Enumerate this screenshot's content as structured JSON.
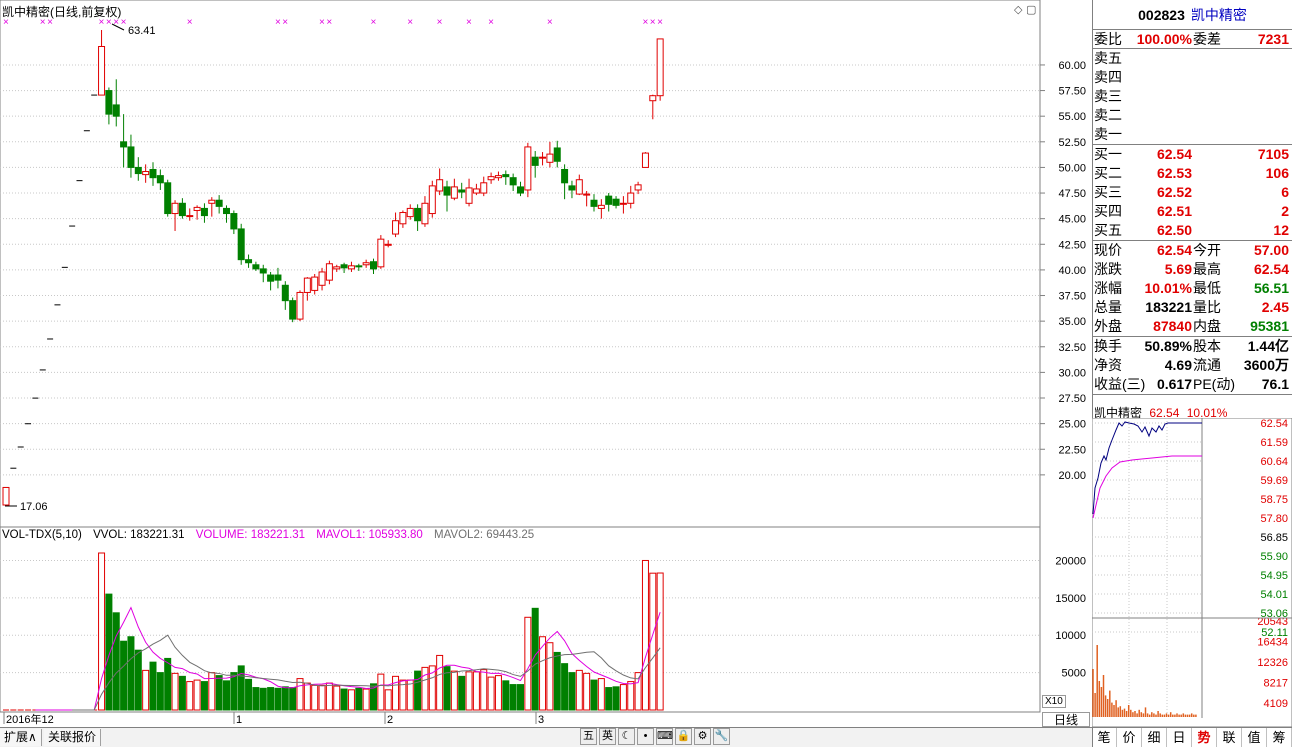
{
  "chart_title": "凯中精密(日线,前复权)",
  "vol_legend": {
    "label": "VOL-TDX(5,10)",
    "vvol": "VVOL: 183221.31",
    "volume": "VOLUME: 183221.31",
    "mavol1": "MAVOL1: 105933.80",
    "mavol2": "MAVOL2: 69443.25"
  },
  "colors": {
    "up": "#e00000",
    "down": "#008000",
    "ma1": "#e000e0",
    "ma2": "#707070",
    "grid": "#c8c8c8"
  },
  "price_axis_labels": [
    "60.00",
    "57.50",
    "55.00",
    "52.50",
    "50.00",
    "47.50",
    "45.00",
    "42.50",
    "40.00",
    "37.50",
    "35.00",
    "32.50",
    "30.00",
    "27.50",
    "25.00",
    "22.50",
    "20.00"
  ],
  "vol_axis_labels": [
    "20000",
    "15000",
    "10000",
    "5000"
  ],
  "annotations": {
    "high": "63.41",
    "low": "17.06"
  },
  "x_labels": {
    "year": "2016年12",
    "m1": "1",
    "m2": "2",
    "m3": "3"
  },
  "chart_data": {
    "type": "candlestick",
    "ylim": [
      17,
      63.5
    ],
    "vol_ylim": [
      0,
      21000
    ],
    "candles": [
      [
        17.06,
        18.77,
        17.06,
        18.77,
        0
      ],
      [
        18.77,
        20.65,
        18.77,
        20.65,
        0
      ],
      [
        20.65,
        22.72,
        20.65,
        22.72,
        0
      ],
      [
        22.72,
        24.99,
        22.72,
        24.99,
        0
      ],
      [
        24.99,
        27.49,
        24.99,
        27.49,
        0
      ],
      [
        27.49,
        30.24,
        27.49,
        30.24,
        0
      ],
      [
        30.24,
        33.26,
        30.24,
        33.26,
        0
      ],
      [
        33.26,
        36.59,
        33.26,
        36.59,
        0
      ],
      [
        36.59,
        40.25,
        36.59,
        40.25,
        0
      ],
      [
        40.25,
        44.28,
        40.25,
        44.28,
        0
      ],
      [
        44.28,
        48.71,
        44.28,
        48.71,
        0
      ],
      [
        48.71,
        53.58,
        48.71,
        53.58,
        0
      ],
      [
        53.58,
        57.06,
        53.58,
        57.06,
        0
      ],
      [
        57.06,
        61.8,
        57.06,
        63.41,
        21000
      ],
      [
        57.5,
        55.2,
        54.2,
        57.8,
        15500
      ],
      [
        56.1,
        55.0,
        54.0,
        58.6,
        13000
      ],
      [
        52.5,
        52.0,
        50.0,
        55.2,
        9200
      ],
      [
        52.0,
        50.0,
        49.0,
        53.2,
        9800
      ],
      [
        50.0,
        49.4,
        48.7,
        51.0,
        8000
      ],
      [
        49.3,
        49.6,
        48.5,
        50.3,
        5300
      ],
      [
        49.8,
        49.0,
        48.2,
        50.5,
        6400
      ],
      [
        49.2,
        48.5,
        47.8,
        49.8,
        5000
      ],
      [
        48.5,
        45.5,
        45.2,
        48.8,
        6900
      ],
      [
        45.5,
        46.5,
        43.8,
        46.8,
        4900
      ],
      [
        46.5,
        45.3,
        45.0,
        47.0,
        4500
      ],
      [
        45.3,
        45.3,
        44.8,
        46.0,
        3800
      ],
      [
        45.8,
        46.1,
        44.9,
        46.3,
        4000
      ],
      [
        46.0,
        45.3,
        44.6,
        46.5,
        3800
      ],
      [
        46.5,
        46.8,
        45.2,
        47.1,
        5000
      ],
      [
        46.8,
        46.2,
        45.5,
        47.3,
        4600
      ],
      [
        46.0,
        45.5,
        44.6,
        46.3,
        3900
      ],
      [
        45.5,
        44.0,
        43.5,
        45.8,
        5000
      ],
      [
        44.0,
        41.0,
        40.5,
        44.5,
        5900
      ],
      [
        41.0,
        40.7,
        40.2,
        41.5,
        4100
      ],
      [
        40.5,
        40.1,
        39.9,
        40.8,
        3000
      ],
      [
        40.1,
        39.7,
        38.8,
        40.5,
        2900
      ],
      [
        39.5,
        38.9,
        38.0,
        39.8,
        3000
      ],
      [
        39.5,
        39.0,
        38.2,
        40.2,
        2900
      ],
      [
        38.5,
        37.0,
        36.1,
        38.9,
        3100
      ],
      [
        37.0,
        35.2,
        34.9,
        37.3,
        3000
      ],
      [
        35.2,
        37.8,
        35.0,
        38.0,
        4200
      ],
      [
        37.8,
        39.2,
        37.0,
        39.3,
        3600
      ],
      [
        38.0,
        39.3,
        37.6,
        39.6,
        3300
      ],
      [
        38.5,
        39.8,
        38.0,
        40.2,
        3300
      ],
      [
        39.0,
        40.6,
        38.6,
        40.9,
        3600
      ],
      [
        40.1,
        40.3,
        39.8,
        40.5,
        3200
      ],
      [
        40.5,
        40.2,
        39.7,
        40.7,
        2800
      ],
      [
        40.1,
        40.4,
        39.8,
        40.8,
        2700
      ],
      [
        40.4,
        40.3,
        39.9,
        40.6,
        2900
      ],
      [
        40.5,
        40.7,
        40.2,
        41.0,
        2800
      ],
      [
        40.8,
        40.1,
        39.6,
        41.1,
        3500
      ],
      [
        40.3,
        43.0,
        40.1,
        43.4,
        4800
      ],
      [
        42.4,
        42.5,
        42.2,
        42.9,
        2700
      ],
      [
        43.5,
        44.8,
        43.2,
        45.6,
        4500
      ],
      [
        44.5,
        45.6,
        44.1,
        45.8,
        4000
      ],
      [
        45.2,
        46.0,
        44.9,
        46.4,
        4000
      ],
      [
        46.0,
        44.8,
        43.8,
        46.4,
        5200
      ],
      [
        44.5,
        46.5,
        44.2,
        47.2,
        5700
      ],
      [
        45.5,
        48.2,
        45.1,
        48.7,
        5900
      ],
      [
        47.7,
        48.8,
        47.3,
        49.9,
        7300
      ],
      [
        48.1,
        47.3,
        45.7,
        48.7,
        5800
      ],
      [
        47.0,
        48.1,
        46.8,
        48.9,
        5200
      ],
      [
        47.8,
        47.6,
        47.0,
        48.5,
        4500
      ],
      [
        46.5,
        48.0,
        46.2,
        48.9,
        5100
      ],
      [
        47.5,
        47.9,
        47.3,
        48.4,
        5100
      ],
      [
        47.5,
        48.5,
        47.2,
        49.1,
        5400
      ],
      [
        48.8,
        49.1,
        48.4,
        49.5,
        4400
      ],
      [
        49.0,
        49.2,
        48.7,
        49.6,
        4600
      ],
      [
        49.3,
        49.1,
        48.3,
        49.7,
        3900
      ],
      [
        49.0,
        48.3,
        47.7,
        49.4,
        3400
      ],
      [
        48.1,
        47.5,
        47.2,
        48.6,
        3400
      ],
      [
        47.8,
        52.0,
        47.1,
        52.4,
        12400
      ],
      [
        51.0,
        50.2,
        49.0,
        51.6,
        13600
      ],
      [
        51.0,
        51.0,
        50.2,
        51.5,
        9800
      ],
      [
        50.5,
        51.3,
        50.0,
        52.5,
        9000
      ],
      [
        51.9,
        50.6,
        50.0,
        52.6,
        7700
      ],
      [
        49.8,
        48.5,
        46.9,
        50.3,
        6200
      ],
      [
        48.2,
        47.8,
        47.0,
        48.7,
        5000
      ],
      [
        47.4,
        48.8,
        47.3,
        49.3,
        5300
      ],
      [
        47.3,
        47.4,
        46.2,
        47.7,
        4900
      ],
      [
        46.8,
        46.2,
        45.7,
        47.4,
        4000
      ],
      [
        46.0,
        46.3,
        45.0,
        46.9,
        4200
      ],
      [
        47.2,
        46.4,
        45.7,
        47.5,
        3000
      ],
      [
        46.9,
        46.3,
        46.0,
        47.2,
        3100
      ],
      [
        46.5,
        46.5,
        45.5,
        47.2,
        3400
      ],
      [
        46.5,
        47.5,
        46.0,
        48.2,
        3800
      ],
      [
        47.8,
        48.3,
        47.4,
        48.6,
        5000
      ],
      [
        50.0,
        51.4,
        50.0,
        51.5,
        20000
      ],
      [
        56.51,
        57.0,
        54.7,
        57.1,
        18300
      ],
      [
        57.0,
        62.54,
        56.51,
        62.54,
        18322
      ]
    ]
  },
  "quote": {
    "code": "002823",
    "name": "凯中精密",
    "wei_bi_label": "委比",
    "wei_bi": "100.00%",
    "wei_cha_label": "委差",
    "wei_cha": "7231",
    "sell": [
      {
        "label": "卖五",
        "price": "",
        "vol": ""
      },
      {
        "label": "卖四",
        "price": "",
        "vol": ""
      },
      {
        "label": "卖三",
        "price": "",
        "vol": ""
      },
      {
        "label": "卖二",
        "price": "",
        "vol": ""
      },
      {
        "label": "卖一",
        "price": "",
        "vol": ""
      }
    ],
    "buy": [
      {
        "label": "买一",
        "price": "62.54",
        "vol": "7105"
      },
      {
        "label": "买二",
        "price": "62.53",
        "vol": "106"
      },
      {
        "label": "买三",
        "price": "62.52",
        "vol": "6"
      },
      {
        "label": "买四",
        "price": "62.51",
        "vol": "2"
      },
      {
        "label": "买五",
        "price": "62.50",
        "vol": "12"
      }
    ],
    "stats1": [
      {
        "l1": "现价",
        "v1": "62.54",
        "l2": "今开",
        "v2": "57.00",
        "c1": "red",
        "c2": "red"
      },
      {
        "l1": "涨跌",
        "v1": "5.69",
        "l2": "最高",
        "v2": "62.54",
        "c1": "red",
        "c2": "red"
      },
      {
        "l1": "涨幅",
        "v1": "10.01%",
        "l2": "最低",
        "v2": "56.51",
        "c1": "red",
        "c2": "green"
      },
      {
        "l1": "总量",
        "v1": "183221",
        "l2": "量比",
        "v2": "2.45",
        "c1": "blk",
        "c2": "red"
      },
      {
        "l1": "外盘",
        "v1": "87840",
        "l2": "内盘",
        "v2": "95381",
        "c1": "red",
        "c2": "green"
      }
    ],
    "stats2": [
      {
        "l1": "换手",
        "v1": "50.89%",
        "l2": "股本",
        "v2": "1.44亿",
        "c1": "blk",
        "c2": "blk"
      },
      {
        "l1": "净资",
        "v1": "4.69",
        "l2": "流通",
        "v2": "3600万",
        "c1": "blk",
        "c2": "blk"
      },
      {
        "l1": "收益(三)",
        "v1": "0.617",
        "l2": "PE(动)",
        "v2": "76.1",
        "c1": "blk",
        "c2": "blk"
      }
    ]
  },
  "mini_chart": {
    "title_name": "凯中精密",
    "title_price": "62.54",
    "title_pct": "10.01%",
    "price_labels": [
      {
        "t": "62.54",
        "c": "red"
      },
      {
        "t": "61.59",
        "c": "red"
      },
      {
        "t": "60.64",
        "c": "red"
      },
      {
        "t": "59.69",
        "c": "red"
      },
      {
        "t": "58.75",
        "c": "red"
      },
      {
        "t": "57.80",
        "c": "red"
      },
      {
        "t": "56.85",
        "c": "blk"
      },
      {
        "t": "55.90",
        "c": "green"
      },
      {
        "t": "54.95",
        "c": "green"
      },
      {
        "t": "54.01",
        "c": "green"
      },
      {
        "t": "53.06",
        "c": "green"
      },
      {
        "t": "52.11",
        "c": "green"
      }
    ],
    "vol_labels": [
      "20543",
      "16434",
      "12326",
      "8217",
      "4109"
    ]
  },
  "bottom_tabs": {
    "expand": "扩展∧",
    "related": "关联报价"
  },
  "tool_icons": [
    "五",
    "英",
    "☾",
    "•",
    "⌨",
    "🔒",
    "⚙",
    "🔧"
  ],
  "day_btn": "日线",
  "x10": "X10",
  "right_tabs": [
    "笔",
    "价",
    "细",
    "日",
    "势",
    "联",
    "值",
    "筹"
  ]
}
